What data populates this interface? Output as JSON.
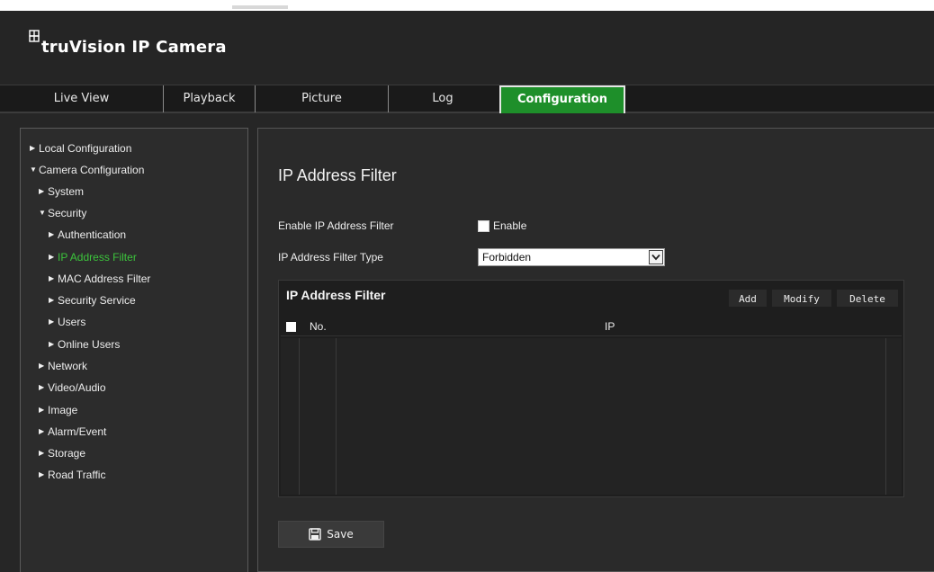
{
  "header": {
    "brand": "truVision IP Camera"
  },
  "nav": {
    "tabs": [
      {
        "label": "Live View"
      },
      {
        "label": "Playback"
      },
      {
        "label": "Picture"
      },
      {
        "label": "Log"
      },
      {
        "label": "Configuration",
        "active": true
      }
    ]
  },
  "sidebar": {
    "items": [
      {
        "label": "Local Configuration",
        "expanded": false
      },
      {
        "label": "Camera Configuration",
        "expanded": true
      },
      {
        "label": "System",
        "expanded": false
      },
      {
        "label": "Security",
        "expanded": true
      },
      {
        "label": "Authentication"
      },
      {
        "label": "IP Address Filter",
        "selected": true
      },
      {
        "label": "MAC Address Filter"
      },
      {
        "label": "Security Service"
      },
      {
        "label": "Users"
      },
      {
        "label": "Online Users"
      },
      {
        "label": "Network"
      },
      {
        "label": "Video/Audio"
      },
      {
        "label": "Image"
      },
      {
        "label": "Alarm/Event"
      },
      {
        "label": "Storage"
      },
      {
        "label": "Road Traffic"
      }
    ]
  },
  "main": {
    "title": "IP Address Filter",
    "enable_label": "Enable IP Address Filter",
    "enable_checkbox_label": "Enable",
    "filter_type_label": "IP Address Filter Type",
    "filter_type_value": "Forbidden",
    "table": {
      "title": "IP Address Filter",
      "buttons": {
        "add": "Add",
        "modify": "Modify",
        "delete": "Delete"
      },
      "columns": [
        "No.",
        "IP"
      ],
      "rows": []
    },
    "save_label": "Save"
  },
  "colors": {
    "accent": "#1e8f2a",
    "selected_text": "#3cc43c",
    "background": "#262626"
  }
}
